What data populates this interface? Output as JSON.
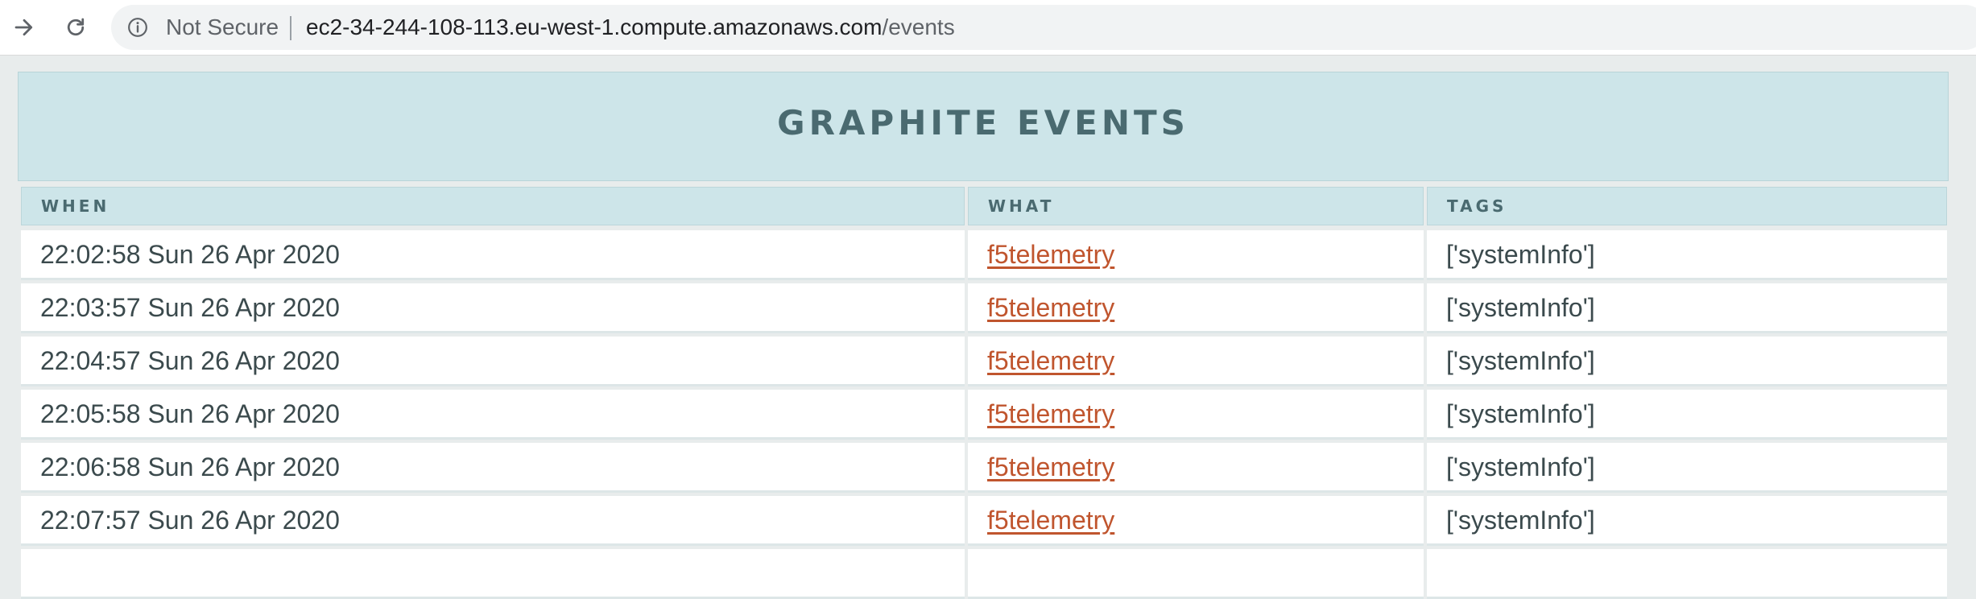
{
  "browser": {
    "security_label": "Not Secure",
    "url_host": "ec2-34-244-108-113.eu-west-1.compute.amazonaws.com",
    "url_path": "/events"
  },
  "page": {
    "title": "GRAPHITE EVENTS"
  },
  "table": {
    "headers": [
      "WHEN",
      "WHAT",
      "TAGS"
    ],
    "rows": [
      {
        "when": "22:02:58 Sun 26 Apr 2020",
        "what": "f5telemetry",
        "tags": "['systemInfo']"
      },
      {
        "when": "22:03:57 Sun 26 Apr 2020",
        "what": "f5telemetry",
        "tags": "['systemInfo']"
      },
      {
        "when": "22:04:57 Sun 26 Apr 2020",
        "what": "f5telemetry",
        "tags": "['systemInfo']"
      },
      {
        "when": "22:05:58 Sun 26 Apr 2020",
        "what": "f5telemetry",
        "tags": "['systemInfo']"
      },
      {
        "when": "22:06:58 Sun 26 Apr 2020",
        "what": "f5telemetry",
        "tags": "['systemInfo']"
      },
      {
        "when": "22:07:57 Sun 26 Apr 2020",
        "what": "f5telemetry",
        "tags": "['systemInfo']"
      },
      {
        "when": "",
        "what": "",
        "tags": ""
      }
    ]
  },
  "colors": {
    "header_bg": "#cde5e9",
    "header_text": "#4a6a70",
    "link": "#c0552e",
    "page_bg": "#e8ecec"
  }
}
